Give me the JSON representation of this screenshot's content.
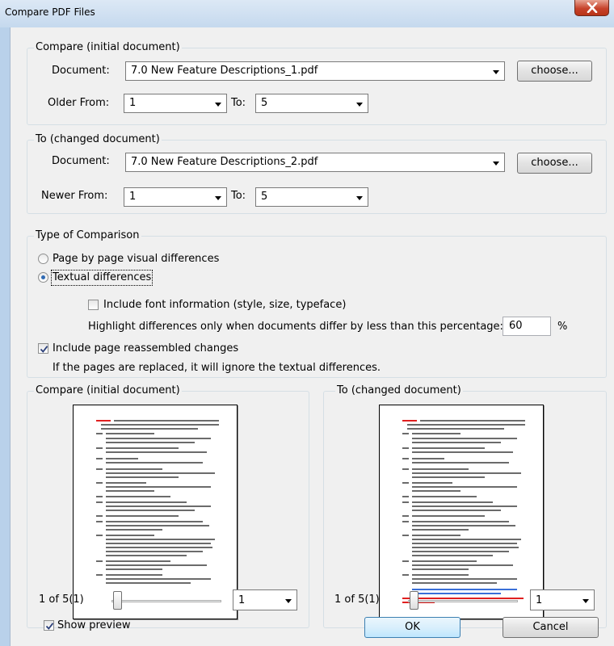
{
  "window": {
    "title": "Compare PDF Files"
  },
  "compare_group": {
    "legend": "Compare (initial document)",
    "document_label": "Document:",
    "document_value": "7.0 New Feature Descriptions_1.pdf",
    "choose_label": "choose...",
    "from_label": "Older From:",
    "from_value": "1",
    "to_label": "To:",
    "to_value": "5"
  },
  "to_group": {
    "legend": "To (changed document)",
    "document_label": "Document:",
    "document_value": "7.0 New Feature Descriptions_2.pdf",
    "choose_label": "choose...",
    "from_label": "Newer From:",
    "from_value": "1",
    "to_label": "To:",
    "to_value": "5"
  },
  "type_group": {
    "legend": "Type of Comparison",
    "radio_visual_label": "Page by page visual differences",
    "radio_visual_checked": false,
    "radio_text_label": "Textual differences",
    "radio_text_checked": true,
    "font_info_label": "Include font information (style, size, typeface)",
    "font_info_checked": false,
    "highlight_label": "Highlight differences only when documents differ by less than this percentage:",
    "percentage_value": "60",
    "percent_sign": "%",
    "reassembled_label": "Include page reassembled changes",
    "reassembled_checked": true,
    "reassembled_note": "If the pages are replaced, it will ignore the textual differences."
  },
  "preview_left": {
    "legend": "Compare (initial document)",
    "page_status": "1  of  5(1)",
    "page_select_value": "1"
  },
  "preview_right": {
    "legend": "To (changed document)",
    "page_status": "1  of  5(1)",
    "page_select_value": "1"
  },
  "footer": {
    "show_preview_label": "Show preview",
    "show_preview_checked": true,
    "ok_label": "OK",
    "cancel_label": "Cancel"
  },
  "colors": {
    "title_bg": "#c5d9ee",
    "dialog_bg": "#f0f0f0",
    "close_red": "#c7432c",
    "preview_highlight_red": "#e02020",
    "preview_highlight_blue": "#3a6fd8"
  }
}
